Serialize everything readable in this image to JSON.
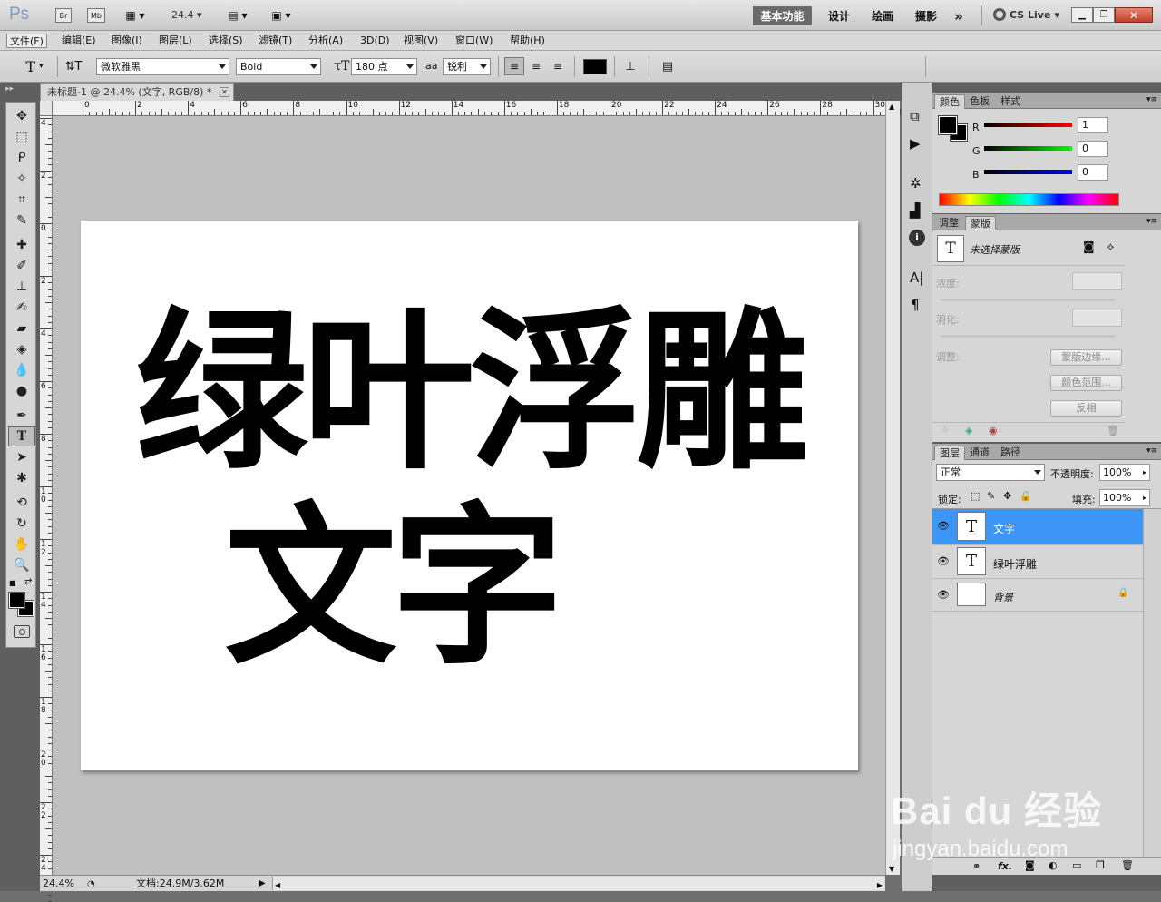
{
  "app": {
    "logo": "Ps",
    "bridge_btn": "Br",
    "minibridge_btn": "Mb",
    "zoom": "24.4",
    "workspaces": [
      "基本功能",
      "设计",
      "绘画",
      "摄影"
    ],
    "more": "»",
    "cslive": "CS Live"
  },
  "menu": [
    "文件(F)",
    "编辑(E)",
    "图像(I)",
    "图层(L)",
    "选择(S)",
    "滤镜(T)",
    "分析(A)",
    "3D(D)",
    "视图(V)",
    "窗口(W)",
    "帮助(H)"
  ],
  "options": {
    "font_family": "微软雅黑",
    "font_style": "Bold",
    "font_size": "180 点",
    "aa_label": "aa",
    "antialias": "锐利",
    "text_color": "#000000"
  },
  "document": {
    "tab_title": "未标题-1 @ 24.4% (文字, RGB/8) *",
    "line1": "绿叶浮雕",
    "line2": "文字",
    "ruler_h": [
      "0",
      "2",
      "4",
      "6",
      "8",
      "10",
      "12",
      "14",
      "16",
      "18",
      "20",
      "22",
      "24",
      "26",
      "28",
      "30"
    ],
    "ruler_v": [
      "4",
      "2",
      "0",
      "2",
      "4",
      "6",
      "8",
      "1 0",
      "1 2",
      "1 4",
      "1 6",
      "1 8",
      "2 0",
      "2 2",
      "2 4"
    ]
  },
  "status": {
    "zoom": "24.4%",
    "doc_info": "文档:24.9M/3.62M"
  },
  "color_panel": {
    "tabs": [
      "颜色",
      "色板",
      "样式"
    ],
    "r_label": "R",
    "g_label": "G",
    "b_label": "B",
    "r": "1",
    "g": "0",
    "b": "0"
  },
  "masks_panel": {
    "tabs": [
      "调整",
      "蒙版"
    ],
    "title": "未选择蒙版",
    "density": "浓度:",
    "feather": "羽化:",
    "refine": "调整:",
    "btn_edge": "蒙版边缘...",
    "btn_range": "颜色范围...",
    "btn_invert": "反相"
  },
  "layers_panel": {
    "tabs": [
      "图层",
      "通道",
      "路径"
    ],
    "blend": "正常",
    "opacity_label": "不透明度:",
    "opacity": "100%",
    "lock_label": "锁定:",
    "fill_label": "填充:",
    "fill": "100%",
    "layers": [
      {
        "name": "文字",
        "thumb": "T"
      },
      {
        "name": "绿叶浮雕",
        "thumb": "T"
      },
      {
        "name": "背景",
        "thumb": ""
      }
    ],
    "fx": "fx."
  },
  "watermark": {
    "brand": "Bai du 经验",
    "url": "jingyan.baidu.com"
  },
  "colors": {
    "selected_row": "#3d95f5",
    "workspace_active": "#6a6a6a"
  }
}
